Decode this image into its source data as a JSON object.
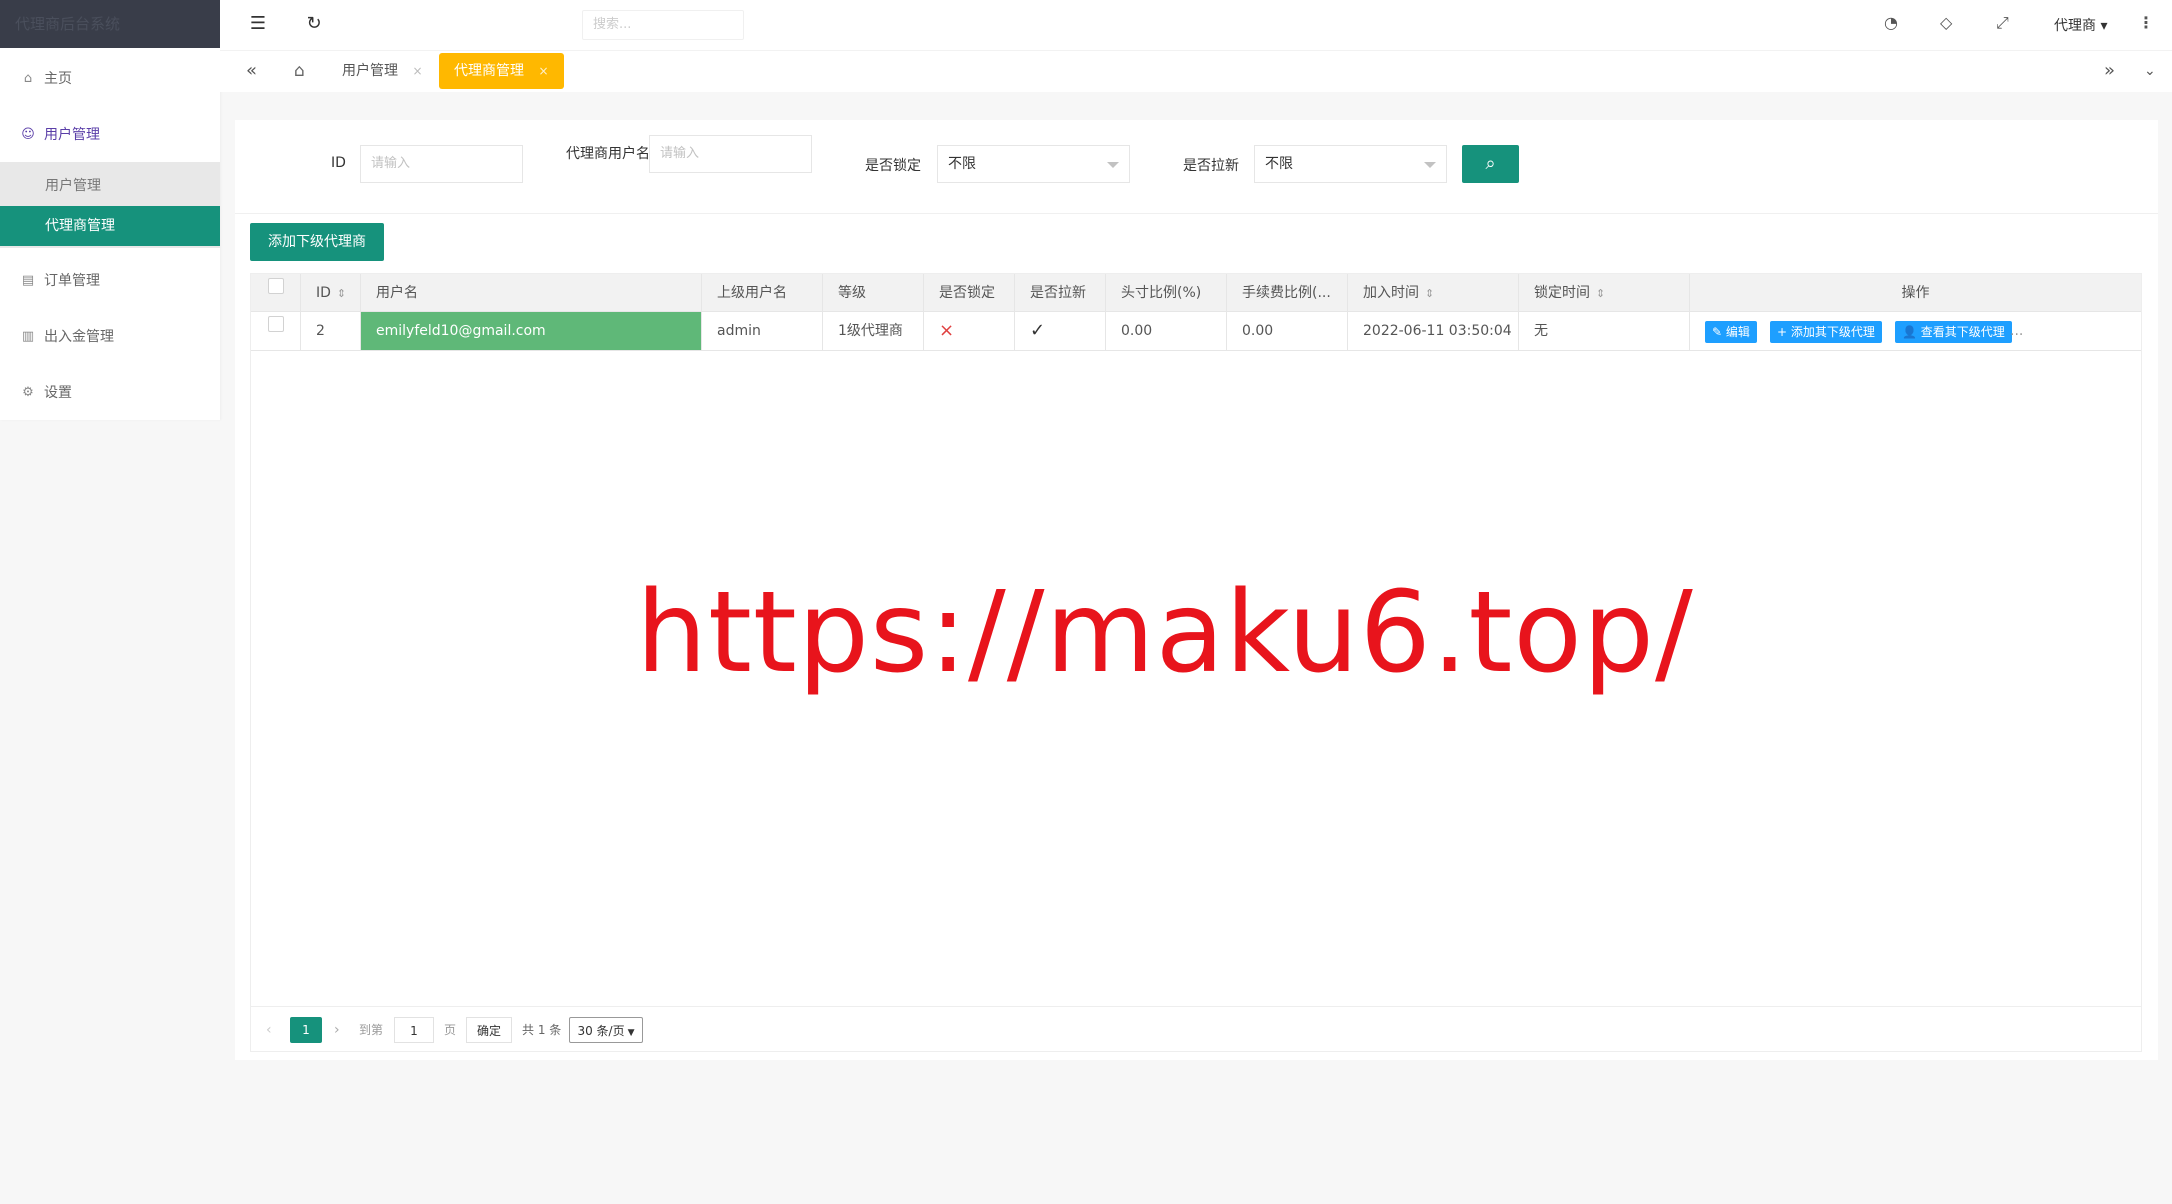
{
  "sidebar": {
    "logo_text": "代理商后台系统",
    "items": [
      {
        "label": "主页",
        "icon": "home-icon"
      },
      {
        "label": "用户管理",
        "icon": "user-icon"
      },
      {
        "label": "订单管理",
        "icon": "order-icon"
      },
      {
        "label": "出入金管理",
        "icon": "money-icon"
      },
      {
        "label": "设置",
        "icon": "gear-icon"
      }
    ],
    "sub_items": [
      {
        "label": "用户管理"
      },
      {
        "label": "代理商管理"
      }
    ]
  },
  "topbar": {
    "search_placeholder": "搜索...",
    "user_label": "代理商",
    "dropdown_glyph": "▾",
    "more_glyph": "⋮"
  },
  "tabs": {
    "items": [
      {
        "label": "用户管理"
      },
      {
        "label": "代理商管理"
      }
    ],
    "close_glyph": "×"
  },
  "filters": {
    "id_label": "ID",
    "id_placeholder": "请输入",
    "agent_username_label": "代理商用户名",
    "agent_username_placeholder": "请输入",
    "locked_label": "是否锁定",
    "locked_value": "不限",
    "pull_new_label": "是否拉新",
    "pull_new_value": "不限"
  },
  "toolbar": {
    "add_label": "添加下级代理商"
  },
  "table": {
    "columns": [
      "ID",
      "用户名",
      "上级用户名",
      "等级",
      "是否锁定",
      "是否拉新",
      "头寸比例(%)",
      "手续费比例(...",
      "加入时间",
      "锁定时间",
      "操作"
    ],
    "rows": [
      {
        "id": "2",
        "username": "emilyfeld10@gmail.com",
        "parent_username": "admin",
        "level": "1级代理商",
        "locked": "×",
        "pull_new": "✓",
        "position_ratio": "0.00",
        "fee_ratio": "0.00",
        "join_time": "2022-06-11 03:50:04",
        "lock_time": "无",
        "actions": {
          "edit": "编辑",
          "add_sub": "添加其下级代理",
          "view_sub": "查看其下级代理",
          "more": "..."
        }
      }
    ]
  },
  "pagination": {
    "current_page": "1",
    "goto_label": "到第",
    "goto_value": "1",
    "page_unit": "页",
    "confirm_label": "确定",
    "total_label": "共 1 条",
    "per_page": "30 条/页"
  },
  "watermark": "https://maku6.top/",
  "colors": {
    "primary": "#16927c",
    "tab_active": "#ffb800",
    "highlight_cell": "#5fb878",
    "action_button": "#1e9fff",
    "watermark": "#e8141c"
  }
}
